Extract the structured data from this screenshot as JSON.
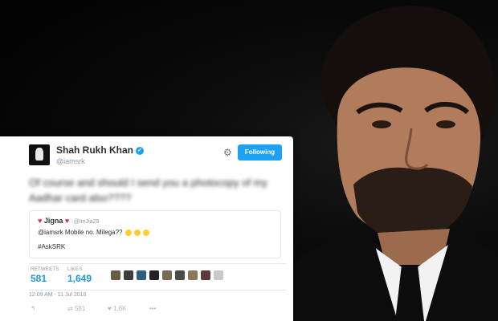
{
  "tweet": {
    "author_name": "Shah Rukh Khan",
    "author_handle": "@iamsrk",
    "follow_label": "Following",
    "reply_text": "Of course and should I send you a photocopy of my Aadhar card also????",
    "quoted": {
      "name": "Jigna",
      "handle": "@ImJia29",
      "text": "@iamsrk Mobile no. Milega??",
      "hashtag": "#AskSRK"
    },
    "stats": {
      "retweets_label": "RETWEETS",
      "retweets": "581",
      "likes_label": "LIKES",
      "likes": "1,649"
    },
    "timestamp": "12:09 AM - 11 Jul 2016",
    "actions": {
      "retweet_count": "581",
      "like_count": "1.6K"
    }
  },
  "colors": {
    "accent": "#1da1f2",
    "heart": "#e0245e",
    "link": "#1b95e0"
  },
  "icons": [
    "avatar-image",
    "verified-icon",
    "gear-icon",
    "heart-icon",
    "reply-icon",
    "retweet-icon",
    "like-icon",
    "more-icon"
  ]
}
